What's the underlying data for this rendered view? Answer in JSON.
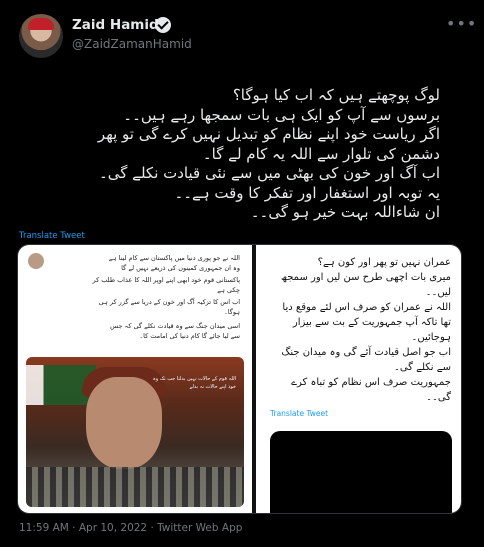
{
  "author": {
    "name": "Zaid Hamid",
    "handle": "@ZaidZamanHamid"
  },
  "icons": {
    "verified": "verified-badge-icon",
    "more": "more-options-icon"
  },
  "tweet": {
    "lines": [
      "لوگ پوچھتے ہیں کہ اب کیا ہوگا؟",
      "برسوں سے آپ کو ایک ہی بات سمجھا رہے ہیں۔۔",
      "اگر ریاست خود اپنے نظام کو تبدیل نہیں کرے گی تو پھر",
      "دشمن کی تلوار سے اللہ یہ کام لے گا۔",
      "اب آگ اور خون کی بھٹی میں سے نئی قیادت نکلے گی۔",
      "یہ توبہ اور استغفار اور تفکر کا وقت ہے۔۔",
      "ان شاءاللہ بہت خیر ہو گی۔۔"
    ],
    "translate_label": "Translate Tweet"
  },
  "media": {
    "left_lines": [
      "اللہ نے جو پوری دنیا میں پاکستان سے کام لینا ہے",
      "وہ ان جمہوری کمینوں کی ذریعے نہیں لے گا",
      "پاکستانی قوم خود ابھی اپنے اوپر اللہ کا عذاب طلب کر",
      "چکی ہے",
      "اب اس کا تزکیہ آگ اور خون کے دریا سے گزر کر ہی",
      "ہوگا۔",
      "اسی میدان جنگ سے وہ قیادت نکلے گی کہ جس",
      "سے لیا جائے گا کام دنیا کی امامت کا۔"
    ],
    "poster_text": "اللہ قوم کے حالات نہیں بدلتا جب تک وہ خود اپنے حالات نہ بدلے",
    "right_lines": [
      "عمران نہیں تو پھر اور کون ہے؟",
      "میری بات اچھی طرح سن لیں اور سمجھ",
      "لیں۔۔",
      "اللہ نے عمران کو صرف اس لئے موقع دیا",
      "تھا تاکہ آپ جمہوریت کے بت سے بیزار",
      "ہوجائیں۔",
      "اب جو اصل قیادت آئے گی وہ میدان جنگ",
      "سے نکلے گی۔",
      "جمہوریت صرف اس نظام کو تباہ کرے",
      "گی۔۔"
    ],
    "right_translate_label": "Translate Tweet"
  },
  "meta": {
    "timestamp": "11:59 AM · Apr 10, 2022 · Twitter Web App"
  }
}
